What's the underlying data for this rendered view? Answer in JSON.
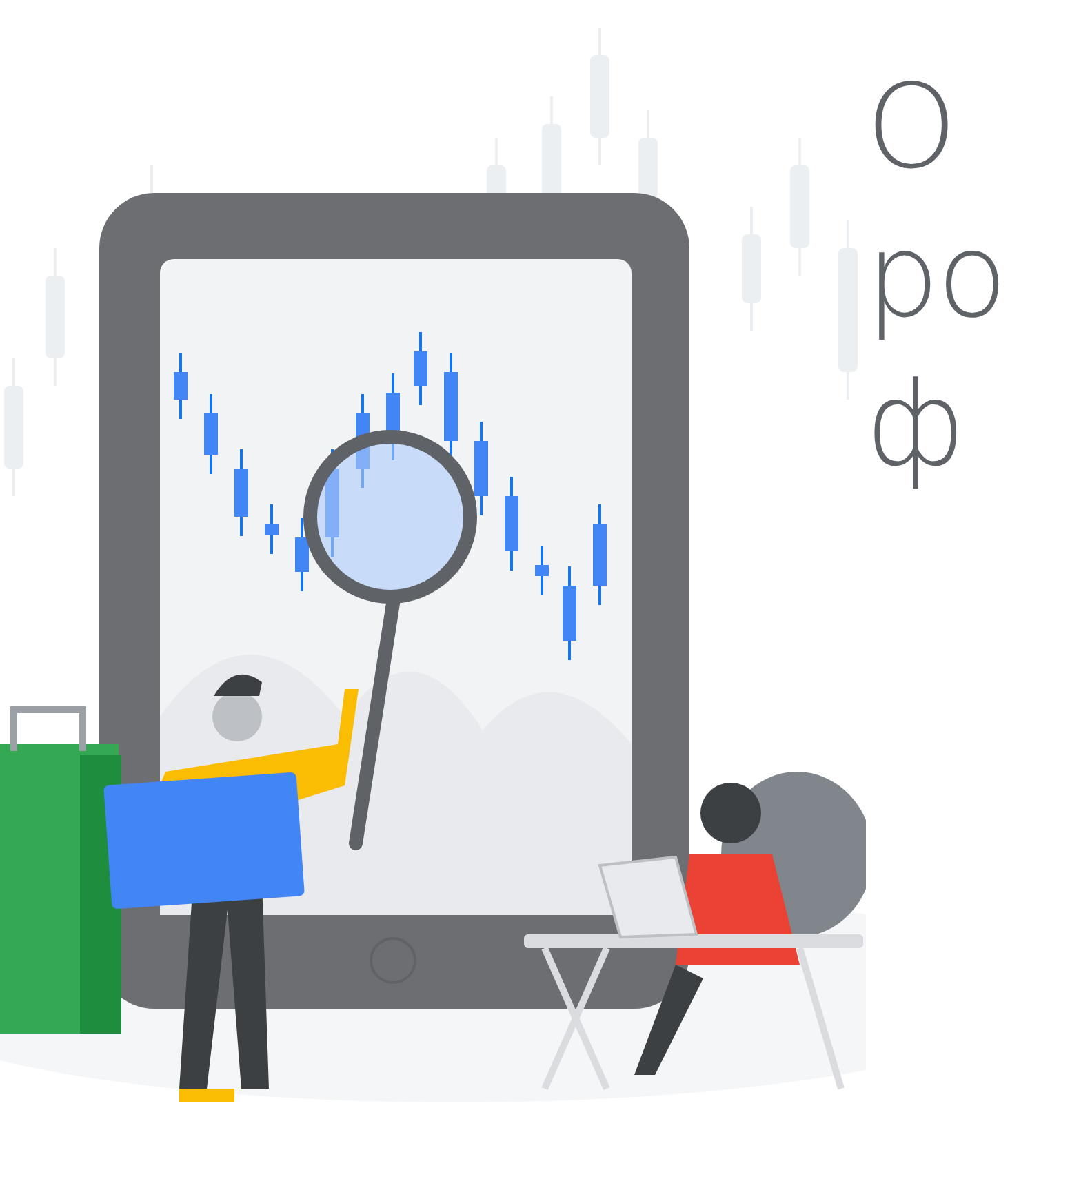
{
  "hero": {
    "heading_lines": [
      "О",
      "ро",
      "ф"
    ]
  }
}
